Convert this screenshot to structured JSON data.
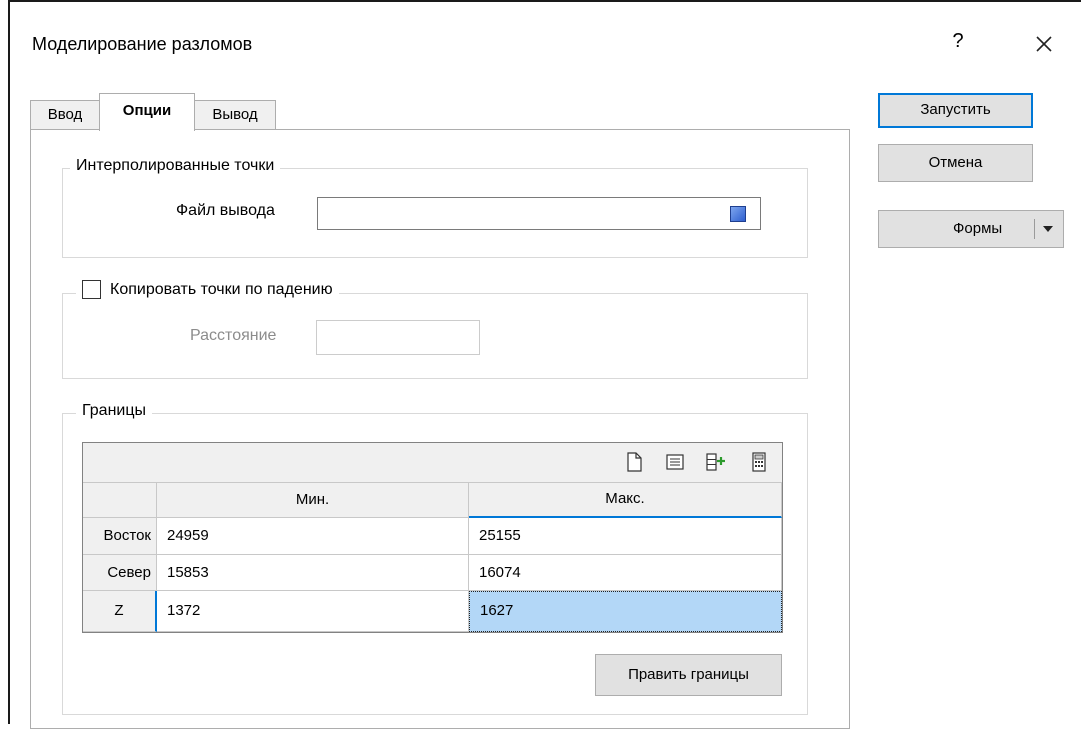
{
  "window": {
    "title": "Моделирование разломов",
    "help_label": "?"
  },
  "tabs": [
    {
      "label": "Ввод"
    },
    {
      "label": "Опции"
    },
    {
      "label": "Вывод"
    }
  ],
  "interpolated": {
    "legend": "Интерполированные точки",
    "output_file_label": "Файл вывода",
    "output_file_value": ""
  },
  "copy_dip": {
    "checkbox_label": "Копировать точки по падению",
    "checked": false,
    "distance_label": "Расстояние",
    "distance_value": ""
  },
  "bounds": {
    "legend": "Границы",
    "columns": [
      "Мин.",
      "Макс."
    ],
    "rows": [
      {
        "label": "Восток",
        "min": "24959",
        "max": "25155"
      },
      {
        "label": "Север",
        "min": "15853",
        "max": "16074"
      },
      {
        "label": "Z",
        "min": "1372",
        "max": "1627"
      }
    ],
    "edit_button": "Править границы",
    "toolbar_icons": [
      "new-file-icon",
      "list-icon",
      "insert-row-icon",
      "calculator-icon"
    ]
  },
  "actions": {
    "run": "Запустить",
    "cancel": "Отмена",
    "forms": "Формы"
  },
  "colors": {
    "accent": "#0078d7",
    "selected_cell": "#b3d7f7",
    "file_icon": "#3b6fd9"
  }
}
